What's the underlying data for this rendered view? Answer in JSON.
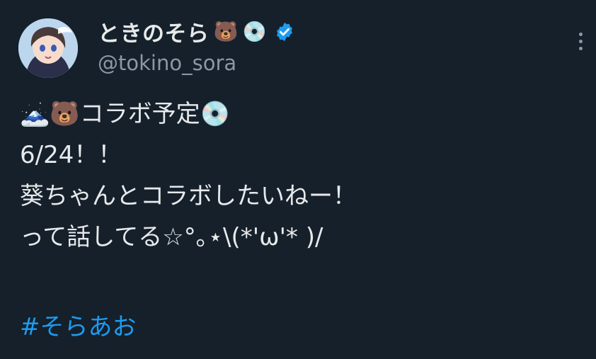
{
  "account": {
    "display_name": "ときのそら",
    "name_emoji_1": "🐻",
    "name_emoji_2": "💿",
    "handle": "@tokino_sora",
    "verified": true
  },
  "icons": {
    "verified": "verified-badge-icon",
    "more": "more-options-icon"
  },
  "tweet": {
    "line1_emoji_a": "🗻",
    "line1_emoji_b": "🐻",
    "line1_text": "コラボ予定",
    "line1_emoji_c": "💿",
    "line2": "6/24！！",
    "line3": "葵ちゃんとコラボしたいねー！",
    "line4": "って話してる☆°｡⋆\\(*'ω'* )/",
    "hashtag": "#そらあお"
  },
  "colors": {
    "background": "#15202b",
    "text": "#e7e9ea",
    "secondary": "#8b98a5",
    "accent": "#1d9bf0"
  }
}
